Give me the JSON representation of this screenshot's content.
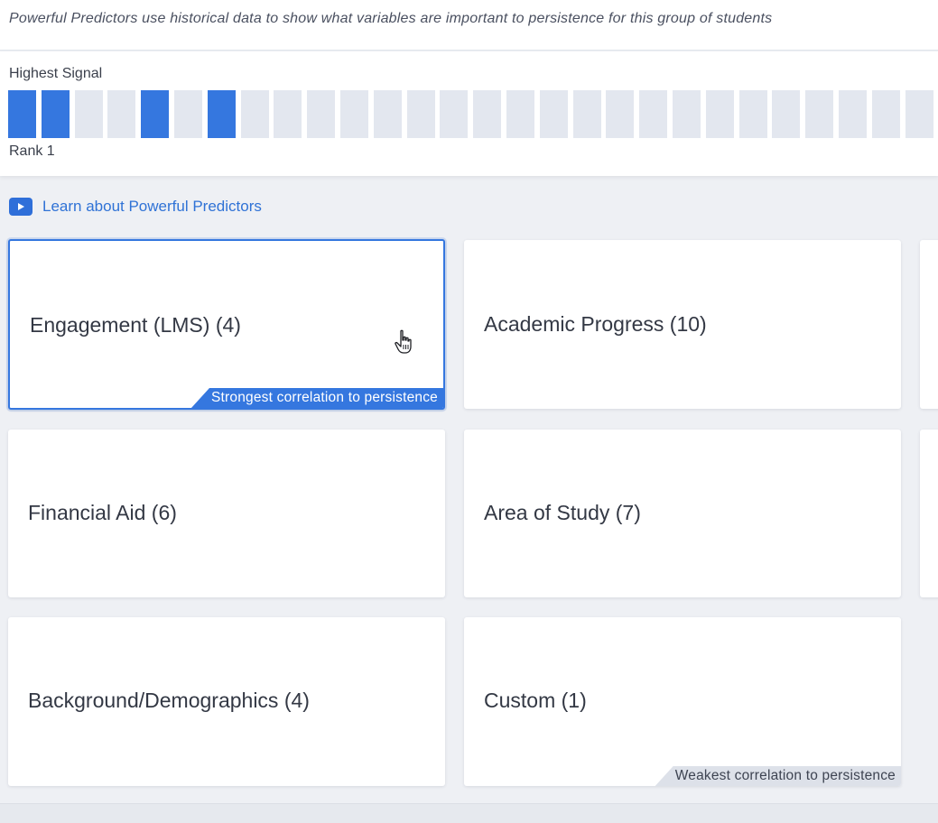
{
  "intro": {
    "text": "Powerful Predictors use historical data to show what variables are important to persistence for this group of students"
  },
  "signal": {
    "title": "Highest Signal",
    "rank_label": "Rank 1",
    "active_color": "#3577df",
    "inactive_color": "#e3e7ef",
    "blocks": [
      true,
      true,
      false,
      false,
      true,
      false,
      true,
      false,
      false,
      false,
      false,
      false,
      false,
      false,
      false,
      false,
      false,
      false,
      false,
      false,
      false,
      false,
      false,
      false,
      false,
      false,
      false,
      false
    ]
  },
  "learn": {
    "icon": "video-play-icon",
    "text": "Learn about Powerful Predictors"
  },
  "cards": [
    {
      "label": "Engagement (LMS) (4)",
      "selected": true,
      "tag": "Strongest correlation to persistence",
      "tag_style": "strong"
    },
    {
      "label": "Academic Progress (10)",
      "selected": false
    },
    {
      "label": "Financial Aid (6)",
      "selected": false
    },
    {
      "label": "Area of Study (7)",
      "selected": false
    },
    {
      "label": "Background/Demographics (4)",
      "selected": false
    },
    {
      "label": "Custom (1)",
      "selected": false,
      "tag": "Weakest correlation to persistence",
      "tag_style": "weak"
    }
  ],
  "cursor": {
    "icon": "hand-pointer-icon"
  }
}
